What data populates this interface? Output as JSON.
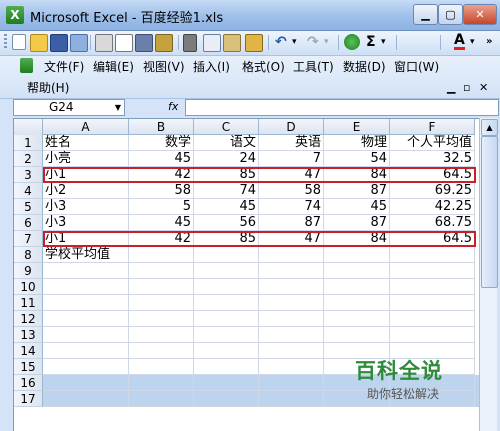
{
  "window": {
    "title": "Microsoft Excel - 百度经验1.xls",
    "app_icon": "X",
    "minimize": "▁",
    "maximize": "▢",
    "close": "✕"
  },
  "toolbar": {
    "sum_glyph": "Σ",
    "font_color_glyph": "A",
    "dropdown_glyph": "▾"
  },
  "menu": {
    "items": [
      "文件(F)",
      "编辑(E)",
      "视图(V)",
      "插入(I)",
      "格式(O)",
      "工具(T)",
      "数据(D)",
      "窗口(W)",
      "帮助(H)"
    ],
    "mdi_minimize": "▁",
    "mdi_restore": "▫",
    "mdi_close": "✕"
  },
  "formula_bar": {
    "name_box": "G24",
    "fx_label": "fx",
    "dropdown": "▼",
    "formula": ""
  },
  "sheet": {
    "columns": [
      "A",
      "B",
      "C",
      "D",
      "E",
      "F"
    ],
    "row_numbers": [
      "1",
      "2",
      "3",
      "4",
      "5",
      "6",
      "7",
      "8",
      "9",
      "10",
      "11",
      "12",
      "13",
      "14",
      "15",
      "16",
      "17"
    ],
    "rows": [
      [
        "姓名",
        "数学",
        "语文",
        "英语",
        "物理",
        "个人平均值"
      ],
      [
        "小亮",
        "45",
        "24",
        "7",
        "54",
        "32.5"
      ],
      [
        "小1",
        "42",
        "85",
        "47",
        "84",
        "64.5"
      ],
      [
        "小2",
        "58",
        "74",
        "58",
        "87",
        "69.25"
      ],
      [
        "小3",
        "5",
        "45",
        "74",
        "45",
        "42.25"
      ],
      [
        "小3",
        "45",
        "56",
        "87",
        "87",
        "68.75"
      ],
      [
        "小1",
        "42",
        "85",
        "47",
        "84",
        "64.5"
      ],
      [
        "学校平均值",
        "",
        "",
        "",
        "",
        ""
      ]
    ],
    "highlighted_rows": [
      3,
      7
    ]
  },
  "watermark": {
    "main": "百科全说",
    "sub": "助你轻松解决"
  }
}
